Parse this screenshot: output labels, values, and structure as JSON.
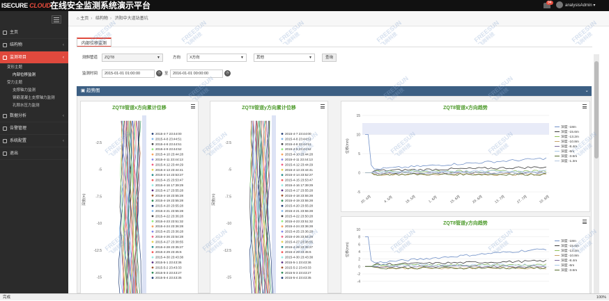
{
  "header": {
    "logo_left": "ISECURE",
    "logo_right": "CLOUD",
    "title": "在线安全监测系统演示平台",
    "badge": "94",
    "user": "analysisAdmin"
  },
  "sidebar": {
    "items": [
      {
        "label": "主页",
        "icon": "home-icon"
      },
      {
        "label": "结构物",
        "icon": "building-icon"
      },
      {
        "label": "监测项目",
        "icon": "monitor-icon",
        "active": true
      },
      {
        "label": "数据分析",
        "icon": "chart-icon"
      },
      {
        "label": "告警管理",
        "icon": "alarm-icon"
      },
      {
        "label": "系统配置",
        "icon": "settings-icon"
      },
      {
        "label": "退出",
        "icon": "logout-icon"
      }
    ],
    "sub": {
      "group1": "变形主题",
      "item1": "内部位移监测",
      "group2": "受力主题",
      "item2": "支撑轴力监测",
      "item3": "钢筋混凝土支撑轴力监测",
      "item4": "孔隙水压力监测"
    }
  },
  "breadcrumb": {
    "home": "主页",
    "level1": "结构物",
    "level2": "济阳中大道站基坑"
  },
  "tab": {
    "label": "内部位移监测"
  },
  "filters": {
    "pipe_label": "测斜管道",
    "pipe_value": "ZQT8",
    "direction_label": "方向",
    "direction_value": "X方向",
    "other_value": "其他",
    "query_button": "查询",
    "time_label": "监测时间",
    "time_start": "2015-01-01 01:00:00",
    "time_end": "2016-01-01 00:00:00",
    "date_sep": "至"
  },
  "panel": {
    "title": "趋势图"
  },
  "chart_data": [
    {
      "type": "line",
      "title": "ZQT8管道x方向累计位移",
      "ylabel": "深度(m)",
      "yticks": [
        -2.5,
        -5,
        -7.5,
        -10,
        -12.5,
        -15
      ],
      "legend": [
        "2015-4-7 23:44:00",
        "2015-4-8 23:44:51",
        "2015-4-8 23:44:51",
        "2015-4-9 23:44:52",
        "2015-4-10 23:44:28",
        "2015-4-11 23:44:13",
        "2015-4-12 23:44:29",
        "2015-4-13 23:44:41",
        "2015-4-14 23:53:27",
        "2015-4-15 23:53:47",
        "2015-4-16 17:39:29",
        "2015-4-17 23:55:28",
        "2015-4-18 23:55:28",
        "2015-4-19 23:55:28",
        "2015-4-20 23:55:28",
        "2015-4-21 23:55:28",
        "2015-4-22 23:36:28",
        "2015-4-23 23:51:32",
        "2015-4-24 23:36:28",
        "2015-4-25 23:36:28",
        "2015-4-26 23:54:28",
        "2015-4-27 23:38:55",
        "2015-4-28 23:35:27",
        "2015-4-29 23:45:6",
        "2015-4-30 23:43:38",
        "2015-5-1 23:43:36",
        "2015-5-2 23:43:33",
        "2015-5-3 23:43:27",
        "2015-5-4 23:43:35"
      ]
    },
    {
      "type": "line",
      "title": "ZQT8管道y方向累计位移",
      "ylabel": "深度(m)",
      "yticks": [
        -2.5,
        -5,
        -7.5,
        -10,
        -12.5,
        -15
      ],
      "legend": [
        "2015-4-7 23:44:00",
        "2015-4-8 23:44:51",
        "2015-4-8 23:44:51",
        "2015-4-9 23:44:52",
        "2015-4-10 23:44:28",
        "2015-4-11 23:44:13",
        "2015-4-12 23:44:29",
        "2015-4-13 23:44:41",
        "2015-4-14 23:52:27",
        "2015-4-15 23:53:47",
        "2015-4-16 17:39:29",
        "2015-4-17 23:55:28",
        "2015-4-18 23:55:28",
        "2015-4-19 23:55:28",
        "2015-4-20 23:55:28",
        "2015-4-21 23:55:28",
        "2015-4-22 23:50:28",
        "2015-4-23 23:51:32",
        "2015-4-24 23:36:28",
        "2015-4-25 23:36:28",
        "2015-4-26 23:54:28",
        "2015-4-27 23:38:55",
        "2015-4-28 23:35:27",
        "2015-4-29 23:45:6",
        "2015-4-30 23:43:38",
        "2015-5-1 23:43:36",
        "2015-5-2 23:43:33",
        "2015-5-3 23:43:27",
        "2015-5-4 23:43:35"
      ]
    },
    {
      "type": "line",
      "title": "ZQT8管道x方向趋势",
      "ylabel": "位移(mm)",
      "ylim": [
        -5,
        15
      ],
      "yticks": [
        15,
        10,
        5,
        0,
        -5
      ],
      "xticks": [
        "20. 4月",
        "4. 5月",
        "18. 5月",
        "1. 6月",
        "15. 6月",
        "29. 6月",
        "13. 7月",
        "27. 7月",
        "10. 8月"
      ],
      "series": [
        {
          "name": "深度 -18m",
          "color": "#6f8fc7"
        },
        {
          "name": "深度 -15.6m",
          "color": "#3a3a3a"
        },
        {
          "name": "深度 -13.2m",
          "color": "#8fbf5a"
        },
        {
          "name": "深度 -10.8m",
          "color": "#c7a36a"
        },
        {
          "name": "深度 -8.4m",
          "color": "#7a6a9a"
        },
        {
          "name": "深度 -6m",
          "color": "#a8c8e8"
        },
        {
          "name": "深度 -3.6m",
          "color": "#556b2f"
        },
        {
          "name": "深度 -1.3m",
          "color": "#b0c4de"
        }
      ]
    },
    {
      "type": "line",
      "title": "ZQT8管道y方向趋势",
      "ylabel": "位移(mm)",
      "ylim": [
        -5,
        10
      ],
      "yticks": [
        10,
        8,
        6,
        4,
        2,
        0,
        -2,
        -4
      ],
      "series": [
        {
          "name": "深度 -18m",
          "color": "#6f8fc7"
        },
        {
          "name": "深度 -15.6m",
          "color": "#3a3a3a"
        },
        {
          "name": "深度 -13.2m",
          "color": "#8fbf5a"
        },
        {
          "name": "深度 -10.8m",
          "color": "#c7a36a"
        },
        {
          "name": "深度 -8.4m",
          "color": "#7a6a9a"
        },
        {
          "name": "深度 -6m",
          "color": "#a8c8e8"
        },
        {
          "name": "深度 -3.6m",
          "color": "#556b2f"
        }
      ]
    }
  ],
  "watermark": {
    "brand": "FREESUN",
    "sub": "飞尚科技"
  },
  "status": {
    "left": "完成",
    "zoom": "100%"
  }
}
